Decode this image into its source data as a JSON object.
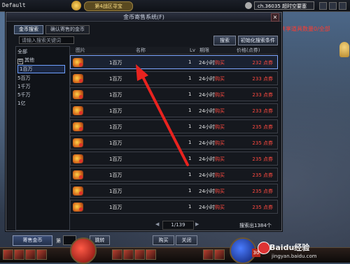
{
  "game_hud": {
    "default_label": "Default",
    "server_name": "第4战区寻宝",
    "channel": "ch.36035 超时空要塞",
    "red_notice": "共享道具数量0/全部"
  },
  "window": {
    "title": "金币寄售系统(F)",
    "close": "×",
    "tabs": [
      {
        "label": "金币搜索",
        "active": true
      },
      {
        "label": "确认寄售的金币",
        "active": false
      }
    ],
    "search_placeholder": "请输入搜索关键词",
    "search_button": "搜索",
    "init_button": "初始化搜索条件"
  },
  "categories": [
    {
      "label": "全部",
      "prefix": ""
    },
    {
      "label": "其他",
      "prefix": "⊟"
    },
    {
      "label": "1百万",
      "prefix": "",
      "selected": true
    },
    {
      "label": "5百万",
      "prefix": ""
    },
    {
      "label": "1千万",
      "prefix": ""
    },
    {
      "label": "5千万",
      "prefix": ""
    },
    {
      "label": "1亿",
      "prefix": ""
    }
  ],
  "table": {
    "headers": {
      "image": "图片",
      "name": "名称",
      "lv": "Lv",
      "period": "期限",
      "price": "价格(点券)"
    },
    "rows": [
      {
        "name": "1百万",
        "lv": "1",
        "period": "24小时",
        "action": "购买",
        "price": "232 点券"
      },
      {
        "name": "1百万",
        "lv": "1",
        "period": "24小时",
        "action": "购买",
        "price": "233 点券"
      },
      {
        "name": "1百万",
        "lv": "1",
        "period": "24小时",
        "action": "购买",
        "price": "233 点券"
      },
      {
        "name": "1百万",
        "lv": "1",
        "period": "24小时",
        "action": "购买",
        "price": "233 点券"
      },
      {
        "name": "1百万",
        "lv": "1",
        "period": "24小时",
        "action": "购买",
        "price": "235 点券"
      },
      {
        "name": "1百万",
        "lv": "1",
        "period": "24小时",
        "action": "购买",
        "price": "235 点券"
      },
      {
        "name": "1百万",
        "lv": "1",
        "period": "24小时",
        "action": "购买",
        "price": "235 点券"
      },
      {
        "name": "1百万",
        "lv": "1",
        "period": "24小时",
        "action": "购买",
        "price": "235 点券"
      },
      {
        "name": "1百万",
        "lv": "1",
        "period": "24小时",
        "action": "购买",
        "price": "235 点券"
      },
      {
        "name": "1百万",
        "lv": "1",
        "period": "24小时",
        "action": "购买",
        "price": "235 点券"
      }
    ]
  },
  "pager": {
    "display": "1/139",
    "prev": "◀",
    "next": "▶",
    "total": "搜索出1384个"
  },
  "bottom": {
    "sell_button": "寄售金币",
    "page_prefix": "第",
    "page_suffix": "页",
    "jump_button": "跳转",
    "buy_button": "购买",
    "close_button": "关闭"
  },
  "hotbar": {
    "level_badge": "30"
  },
  "watermark": {
    "title": "Baidu经验",
    "url": "jingyan.baidu.com"
  },
  "accent_colors": {
    "price_red": "#ff4a40",
    "selection_blue": "#7ea6ff",
    "annotation_arrow": "#e8231f"
  }
}
